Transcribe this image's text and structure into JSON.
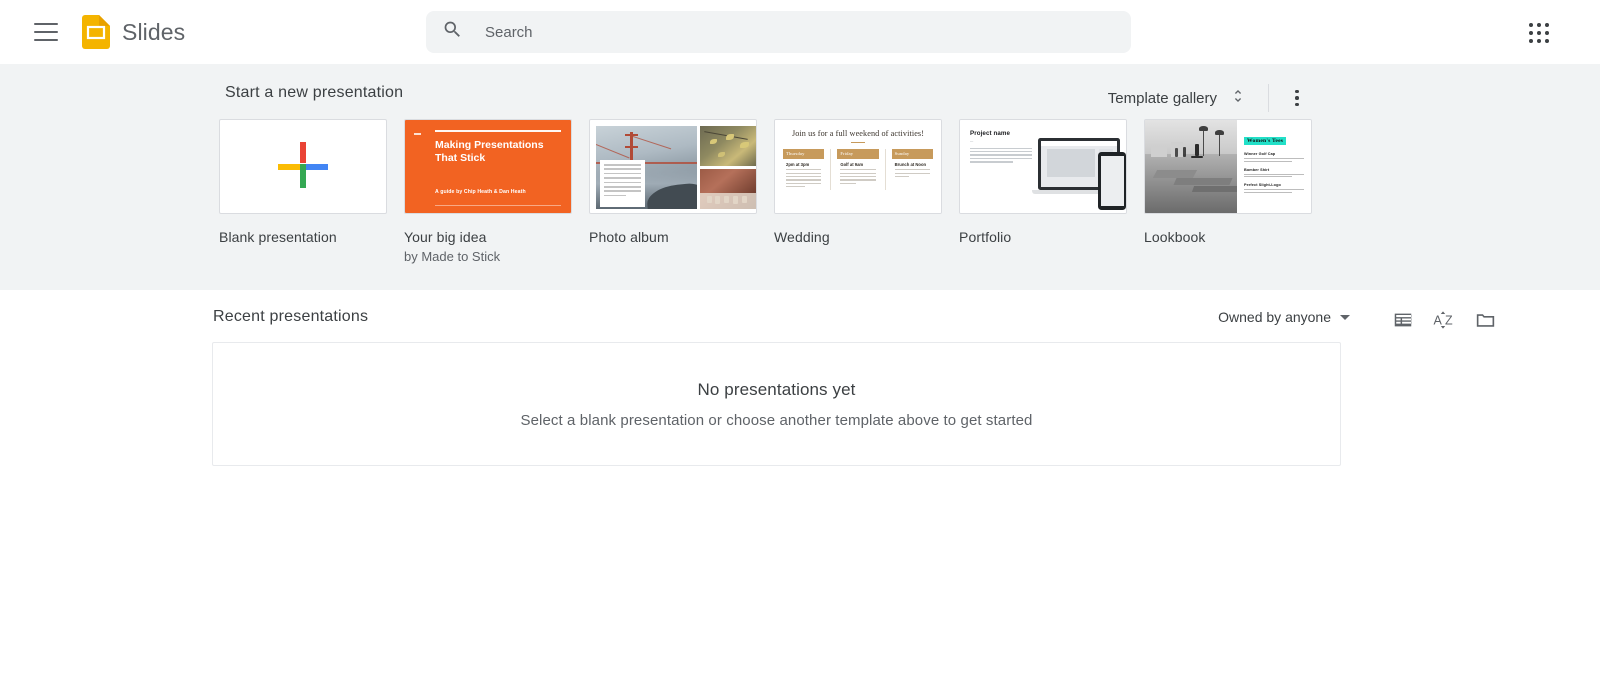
{
  "header": {
    "menu_icon": "hamburger-menu-icon",
    "logo_icon": "slides-logo-icon",
    "app_name": "Slides",
    "search": {
      "icon": "search-icon",
      "placeholder": "Search",
      "value": ""
    },
    "apps_icon": "google-apps-grid-icon"
  },
  "templates_section": {
    "title": "Start a new presentation",
    "template_gallery_label": "Template gallery",
    "expand_icon": "unfold-more-icon",
    "more_icon": "more-vert-icon",
    "items": [
      {
        "label": "Blank presentation",
        "sub": "",
        "thumb": "google-plus-icon"
      },
      {
        "label": "Your big idea",
        "sub": "by Made to Stick",
        "thumb_title": "Making Presentations That Stick",
        "thumb_byline": "A guide by Chip Heath & Dan Heath",
        "accent": "#f26322"
      },
      {
        "label": "Photo album",
        "sub": "",
        "thumb": "photo-collage"
      },
      {
        "label": "Wedding",
        "sub": "",
        "thumb_heading": "Join us for a full weekend of activities!",
        "columns": [
          {
            "day": "Thursday",
            "heading": "2pm at 3pm"
          },
          {
            "day": "Friday",
            "heading": "Golf at 9am"
          },
          {
            "day": "Sunday",
            "heading": "Brunch at Noon"
          }
        ],
        "accent": "#c79a5b"
      },
      {
        "label": "Portfolio",
        "sub": "",
        "thumb_title": "Project name"
      },
      {
        "label": "Lookbook",
        "sub": "",
        "thumb_highlight": "Women's Tees",
        "entries": [
          "Winner Golf Cap",
          "Bomber Shirt",
          "Perfect Slight-Logo"
        ],
        "accent": "#22e0c8"
      }
    ]
  },
  "recent_section": {
    "title": "Recent presentations",
    "owner_filter": "Owned by anyone",
    "list_view_icon": "list-view-icon",
    "sort_icon": "sort-az-icon",
    "folder_icon": "folder-icon",
    "empty_state": {
      "title": "No presentations yet",
      "subtitle": "Select a blank presentation or choose another template above to get started"
    }
  },
  "colors": {
    "band_background": "#f1f3f4",
    "text_primary": "#3c4043",
    "text_secondary": "#5f6368",
    "logo_yellow": "#f4b400"
  }
}
